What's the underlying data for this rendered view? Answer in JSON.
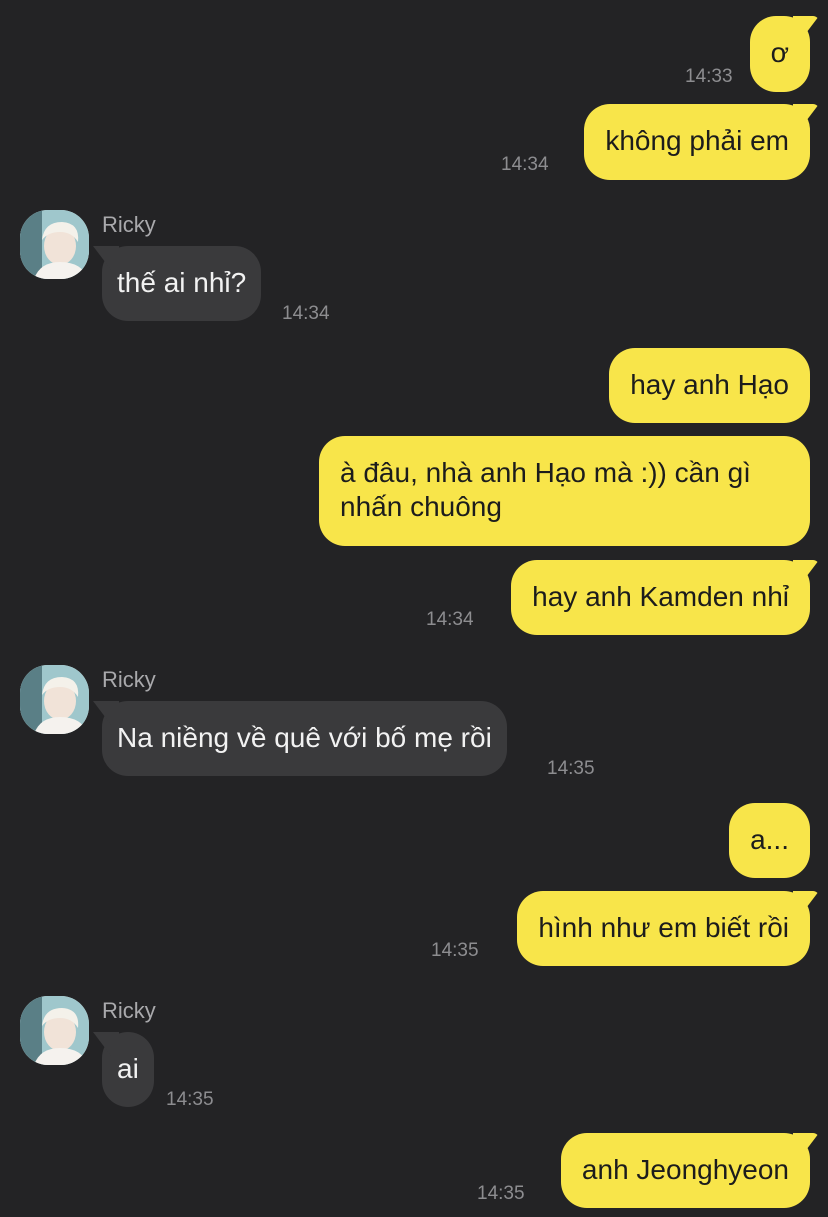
{
  "contact": {
    "name": "Ricky"
  },
  "colors": {
    "background": "#232325",
    "outgoing_bubble": "#f8e54a",
    "incoming_bubble": "#3a3a3c",
    "timestamp": "#8d8d90"
  },
  "messages": [
    {
      "direction": "out",
      "text": "ơ",
      "time": "14:33"
    },
    {
      "direction": "out",
      "text": "không phải em",
      "time": "14:34"
    },
    {
      "direction": "in",
      "sender": "Ricky",
      "text": "thế ai nhỉ?",
      "time": "14:34"
    },
    {
      "direction": "out",
      "text": "hay anh Hạo",
      "time": ""
    },
    {
      "direction": "out",
      "text": "à đâu, nhà anh Hạo mà :)) cần gì\nnhấn chuông",
      "time": ""
    },
    {
      "direction": "out",
      "text": "hay anh Kamden nhỉ",
      "time": "14:34"
    },
    {
      "direction": "in",
      "sender": "Ricky",
      "text": "Na niềng về quê với bố mẹ rồi",
      "time": "14:35"
    },
    {
      "direction": "out",
      "text": "a...",
      "time": ""
    },
    {
      "direction": "out",
      "text": "hình như em biết rồi",
      "time": "14:35"
    },
    {
      "direction": "in",
      "sender": "Ricky",
      "text": "ai",
      "time": "14:35"
    },
    {
      "direction": "out",
      "text": "anh Jeonghyeon",
      "time": "14:35"
    }
  ]
}
